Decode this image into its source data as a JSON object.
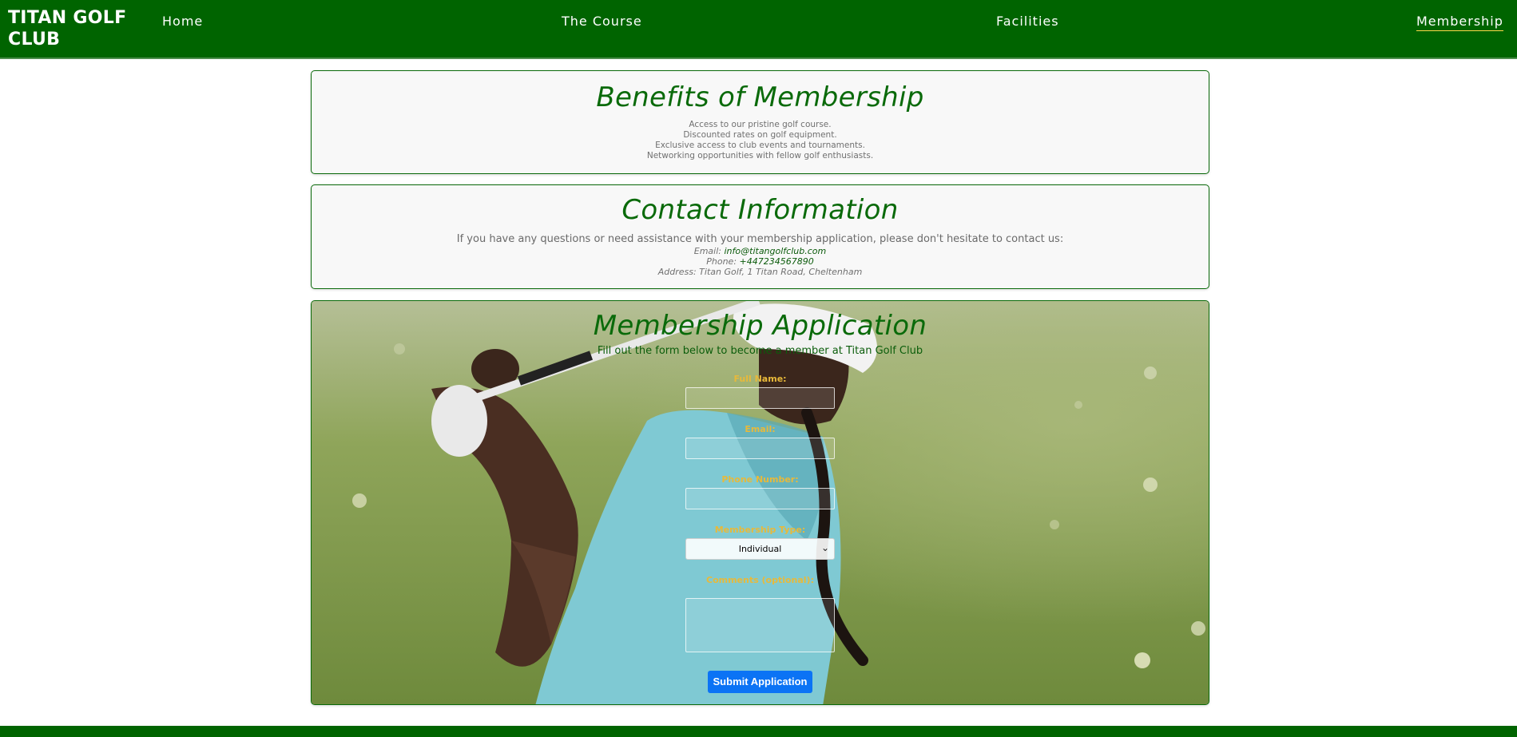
{
  "nav": {
    "brand": "TITAN GOLF CLUB",
    "links": [
      "Home",
      "The Course",
      "Facilities",
      "Membership"
    ],
    "active": "Membership"
  },
  "benefits": {
    "title": "Benefits of Membership",
    "items": [
      "Access to our pristine golf course.",
      "Discounted rates on golf equipment.",
      "Exclusive access to club events and tournaments.",
      "Networking opportunities with fellow golf enthusiasts."
    ]
  },
  "contact": {
    "title": "Contact Information",
    "intro": "If you have any questions or need assistance with your membership application, please don't hesitate to contact us:",
    "email_label": "Email:",
    "email": "info@titangolfclub.com",
    "phone_label": "Phone:",
    "phone": "+447234567890",
    "address": "Address: Titan Golf, 1 Titan Road, Cheltenham"
  },
  "application": {
    "title": "Membership Application",
    "lead": "Fill out the form below to become a member at Titan Golf Club",
    "labels": {
      "full_name": "Full Name:",
      "email": "Email:",
      "phone": "Phone Number:",
      "membership_type": "Membership Type:",
      "comments": "Comments (optional):"
    },
    "membership_type_value": "Individual",
    "submit": "Submit Application"
  },
  "colors": {
    "brand_green": "#006400",
    "heading_green": "#0a6a0a",
    "label_gold": "#e8b93a",
    "submit_blue": "#0b73f5"
  },
  "icons": [
    "chevron-down-icon"
  ]
}
